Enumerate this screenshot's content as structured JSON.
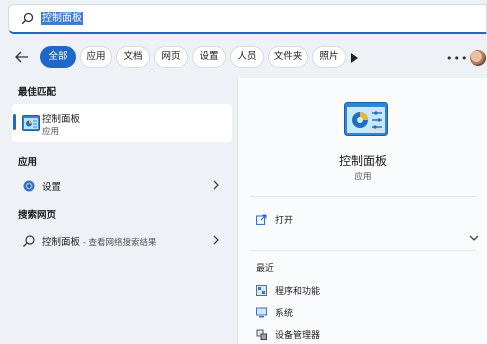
{
  "search": {
    "query": "控制面板"
  },
  "filters": {
    "chips": [
      "全部",
      "应用",
      "文档",
      "网页",
      "设置",
      "人员",
      "文件夹",
      "照片"
    ],
    "active_index": 0,
    "more": "•••"
  },
  "results": {
    "best_match_title": "最佳匹配",
    "best_match": {
      "title": "控制面板",
      "subtitle": "应用"
    },
    "apps_title": "应用",
    "apps": [
      {
        "label": "设置"
      }
    ],
    "web_title": "搜索网页",
    "web": [
      {
        "label": "控制面板",
        "desc": " - 查看网络搜索结果"
      }
    ]
  },
  "preview": {
    "title": "控制面板",
    "subtitle": "应用",
    "actions": [
      {
        "label": "打开",
        "icon": "open-icon"
      }
    ],
    "recent_title": "最近",
    "recent": [
      {
        "label": "程序和功能",
        "icon": "programs-icon"
      },
      {
        "label": "系统",
        "icon": "system-icon"
      },
      {
        "label": "设备管理器",
        "icon": "device-manager-icon"
      }
    ]
  },
  "colors": {
    "accent": "#1f67c8",
    "background": "#eef1f6"
  }
}
